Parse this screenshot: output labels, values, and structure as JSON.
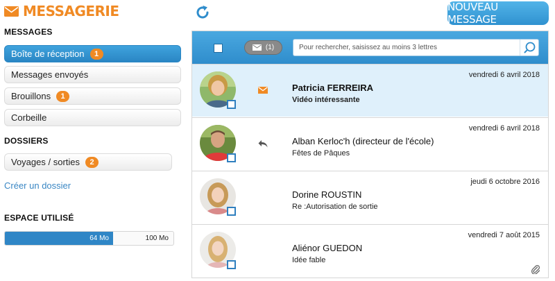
{
  "app": {
    "title": "MESSAGERIE"
  },
  "sidebar": {
    "messages_title": "MESSAGES",
    "folders": [
      {
        "label": "Boîte de réception",
        "badge": "1"
      },
      {
        "label": "Messages envoyés",
        "badge": ""
      },
      {
        "label": "Brouillons",
        "badge": "1"
      },
      {
        "label": "Corbeille",
        "badge": ""
      }
    ],
    "dossiers_title": "DOSSIERS",
    "dossiers": [
      {
        "label": "Voyages / sorties",
        "badge": "2"
      }
    ],
    "create_folder_link": "Créer un dossier",
    "storage_title": "ESPACE UTILISÉ",
    "storage": {
      "used_label": "64 Mo",
      "total_label": "100 Mo",
      "used_fraction": 0.64
    }
  },
  "header": {
    "new_message_label": "NOUVEAU MESSAGE"
  },
  "toolbar": {
    "filter_count": "(1)",
    "search_placeholder": "Pour rechercher, saisissez au moins 3 lettres"
  },
  "messages": [
    {
      "date": "vendredi 6 avril 2018",
      "sender": "Patricia FERREIRA",
      "subject": "Vidéo intéressante",
      "unread": true,
      "status_icon": "envelope-icon",
      "attachment": false
    },
    {
      "date": "vendredi 6 avril 2018",
      "sender": "Alban Kerloc'h (directeur de l'école)",
      "subject": "Fêtes de Pâques",
      "unread": false,
      "status_icon": "reply-icon",
      "attachment": false
    },
    {
      "date": "jeudi 6 octobre 2016",
      "sender": "Dorine ROUSTIN",
      "subject": "Re :Autorisation de sortie",
      "unread": false,
      "status_icon": "",
      "attachment": false
    },
    {
      "date": "vendredi 7 août 2015",
      "sender": "Aliénor GUEDON",
      "subject": "Idée fable",
      "unread": false,
      "status_icon": "",
      "attachment": true
    }
  ],
  "colors": {
    "accent_orange": "#f08a24",
    "accent_blue": "#2f8dcc",
    "selected_row": "#dff0fb"
  }
}
